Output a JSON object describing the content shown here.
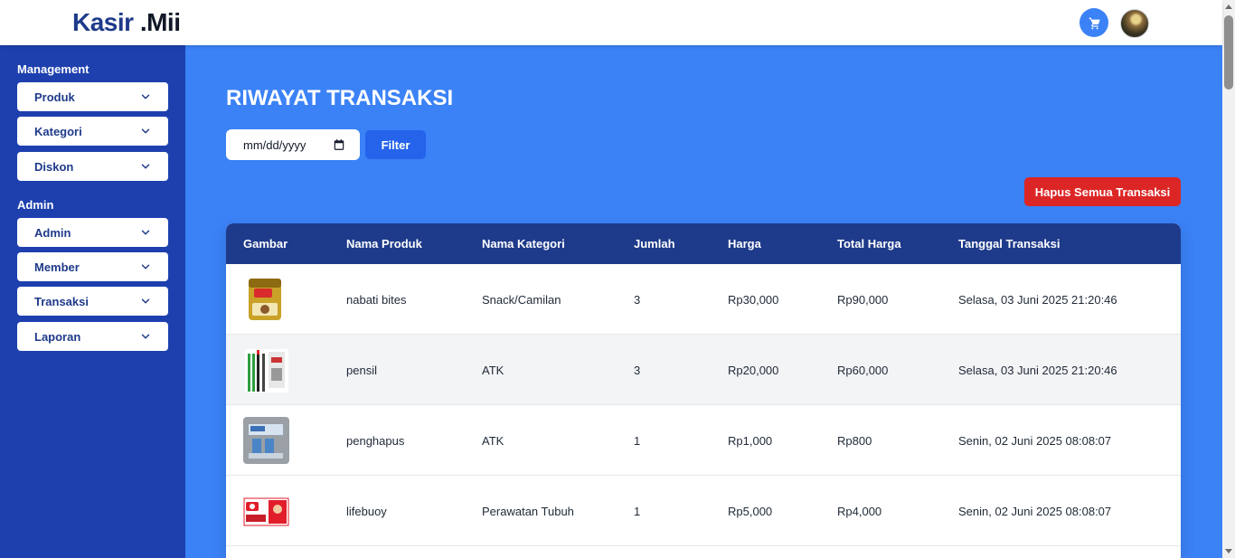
{
  "header": {
    "logo_main": "Kasir",
    "logo_suffix": ".Mii",
    "cart_icon": "cart-icon",
    "avatar_icon": "user-avatar"
  },
  "sidebar": {
    "management_title": "Management",
    "management_items": [
      {
        "label": "Produk"
      },
      {
        "label": "Kategori"
      },
      {
        "label": "Diskon"
      }
    ],
    "admin_title": "Admin",
    "admin_items": [
      {
        "label": "Admin"
      },
      {
        "label": "Member"
      },
      {
        "label": "Transaksi"
      },
      {
        "label": "Laporan"
      }
    ]
  },
  "main": {
    "title": "RIWAYAT TRANSAKSI",
    "date_placeholder": "mm/dd/yyyy",
    "filter_label": "Filter",
    "delete_all_label": "Hapus Semua Transaksi"
  },
  "table": {
    "headers": [
      "Gambar",
      "Nama Produk",
      "Nama Kategori",
      "Jumlah",
      "Harga",
      "Total Harga",
      "Tanggal Transaksi"
    ],
    "rows": [
      {
        "image": "nabati-bites-product-image",
        "nama_produk": "nabati bites",
        "kategori": "Snack/Camilan",
        "jumlah": "3",
        "harga": "Rp30,000",
        "total": "Rp90,000",
        "tanggal": "Selasa, 03 Juni 2025 21:20:46"
      },
      {
        "image": "pensil-product-image",
        "nama_produk": "pensil",
        "kategori": "ATK",
        "jumlah": "3",
        "harga": "Rp20,000",
        "total": "Rp60,000",
        "tanggal": "Selasa, 03 Juni 2025 21:20:46"
      },
      {
        "image": "penghapus-product-image",
        "nama_produk": "penghapus",
        "kategori": "ATK",
        "jumlah": "1",
        "harga": "Rp1,000",
        "total": "Rp800",
        "tanggal": "Senin, 02 Juni 2025 08:08:07"
      },
      {
        "image": "lifebuoy-product-image",
        "nama_produk": "lifebuoy",
        "kategori": "Perawatan Tubuh",
        "jumlah": "1",
        "harga": "Rp5,000",
        "total": "Rp4,000",
        "tanggal": "Senin, 02 Juni 2025 08:08:07"
      }
    ]
  },
  "colors": {
    "header_bg": "#ffffff",
    "sidebar_bg": "#1e40af",
    "main_bg": "#3b82f6",
    "table_head": "#1e3a8a",
    "filter_btn": "#2563eb",
    "danger_btn": "#dc2626"
  }
}
